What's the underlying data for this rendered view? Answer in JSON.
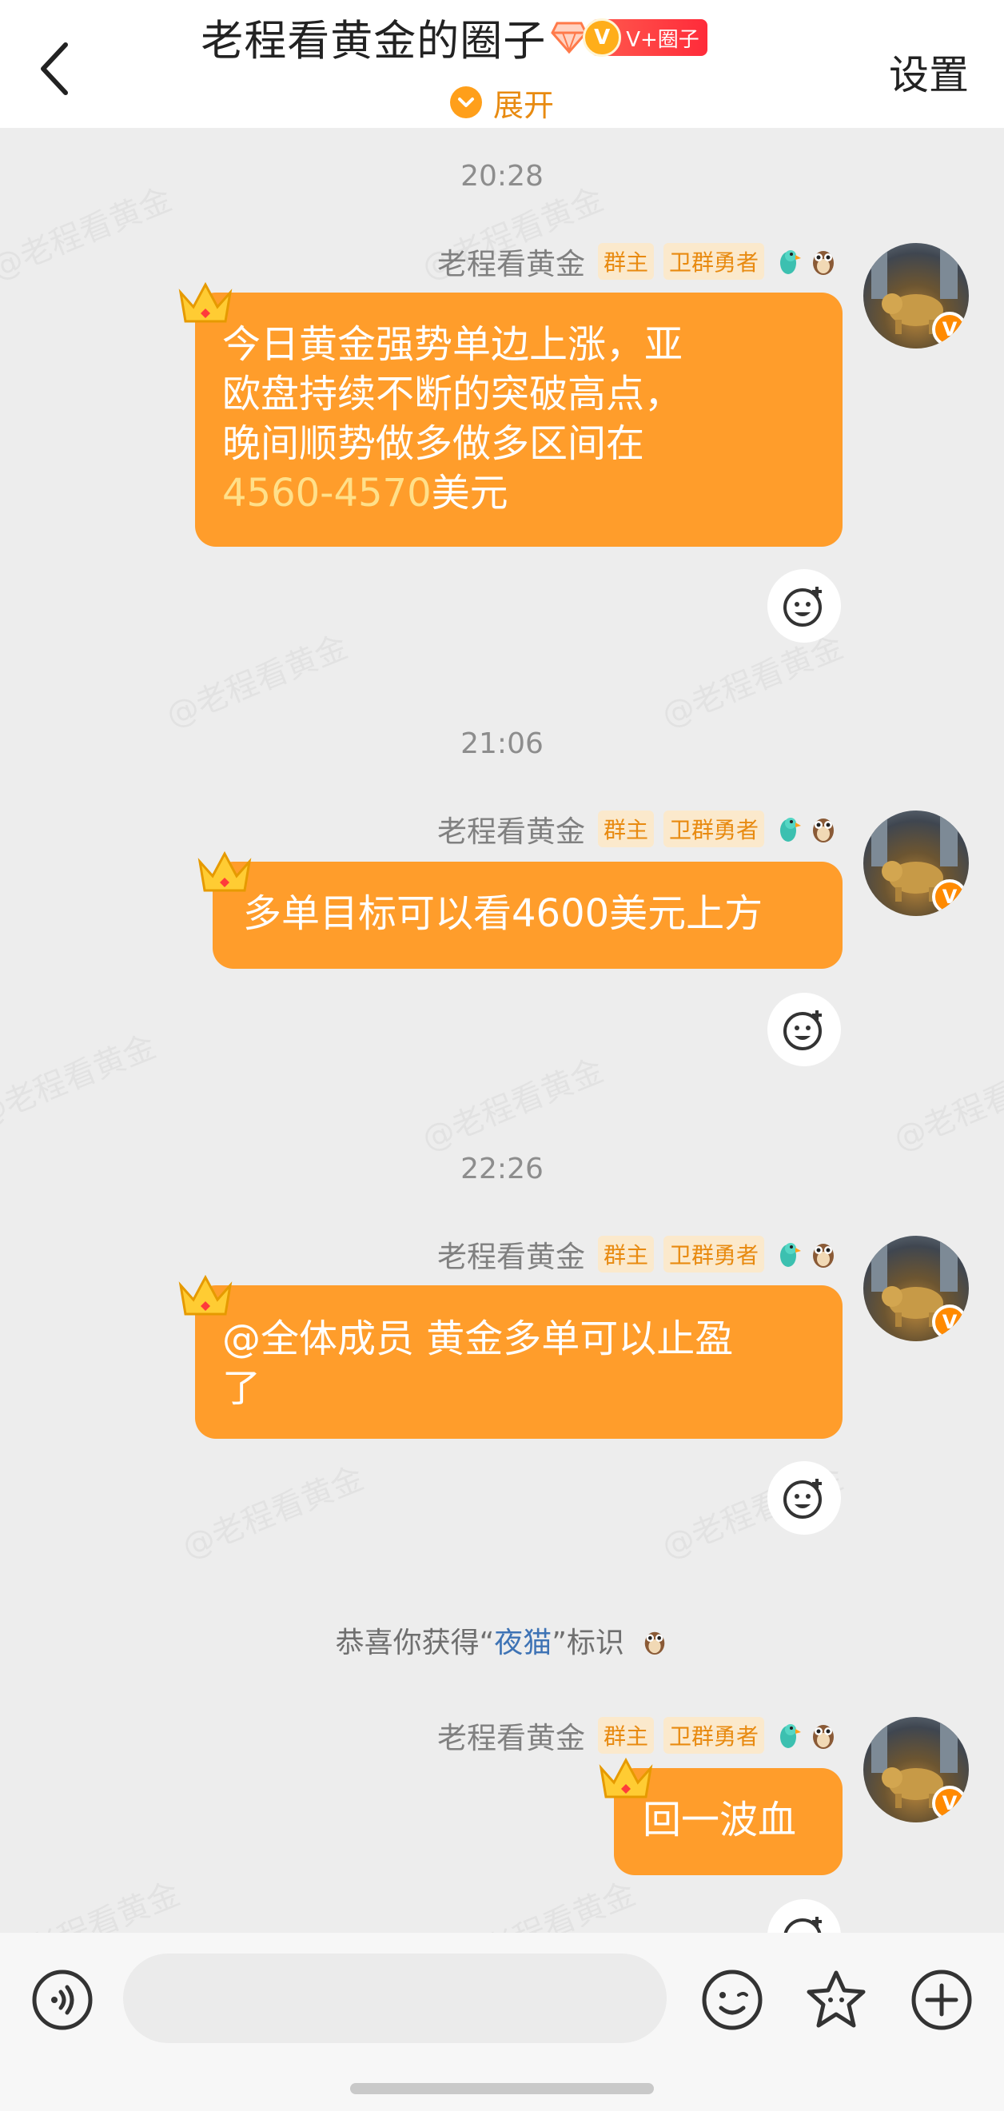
{
  "header": {
    "back_icon": "chevron-left-icon",
    "title": "老程看黄金的圈子",
    "badge_label": "V+圈子",
    "badge_coin": "V",
    "settings_label": "设置",
    "expand_label": "展开"
  },
  "watermark": "@老程看黄金",
  "messages": [
    {
      "time": "20:28",
      "sender": "老程看黄金",
      "tags": [
        "群主",
        "卫群勇者"
      ],
      "text_lines": [
        "今日黄金强势单边上涨，亚",
        "欧盘持续不断的突破高点，",
        "晚间顺势做多做多区间在"
      ],
      "highlight": "4560-4570",
      "text_tail": "美元"
    },
    {
      "time": "21:06",
      "sender": "老程看黄金",
      "tags": [
        "群主",
        "卫群勇者"
      ],
      "text": "多单目标可以看4600美元上方"
    },
    {
      "time": "22:26",
      "sender": "老程看黄金",
      "tags": [
        "群主",
        "卫群勇者"
      ],
      "text_lines": [
        "@全体成员 黄金多单可以止盈",
        "了"
      ]
    },
    {
      "sender": "老程看黄金",
      "tags": [
        "群主",
        "卫群勇者"
      ],
      "text": "回一波血"
    }
  ],
  "system_notice": {
    "prefix": "恭喜你获得“",
    "link": "夜猫",
    "suffix": "”标识"
  },
  "avatar_mark": "V",
  "input": {
    "placeholder": "",
    "voice_icon": "voice-icon",
    "emoji_icon": "emoji-icon",
    "sticker_icon": "star-sticker-icon",
    "plus_icon": "plus-icon"
  },
  "colors": {
    "bubble": "#ff9d2b",
    "accent": "#e88a10",
    "highlight": "#ffe08a",
    "link": "#3e73b5"
  }
}
